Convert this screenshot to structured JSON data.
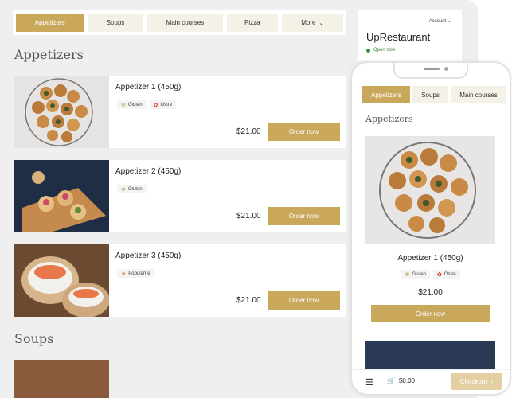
{
  "nav": {
    "tabs": [
      "Appetizers",
      "Soups",
      "Main courses",
      "Pizza",
      "More"
    ]
  },
  "restaurant": {
    "account": "Account",
    "name": "UpRestaurant",
    "status": "Open now"
  },
  "sections": {
    "appetizers": "Appetizers",
    "soups": "Soups"
  },
  "items": [
    {
      "name": "Appetizer 1 (450g)",
      "tags": [
        "Gluten",
        "Ostre"
      ],
      "price": "$21.00",
      "order": "Order now"
    },
    {
      "name": "Appetizer 2 (450g)",
      "tags": [
        "Gluten"
      ],
      "price": "$21.00",
      "order": "Order now"
    },
    {
      "name": "Appetizer 3 (450g)",
      "tags": [
        "Popularne"
      ],
      "price": "$21.00",
      "order": "Order now"
    }
  ],
  "mobile": {
    "tabs": [
      "Appetizers",
      "Soups",
      "Main courses"
    ],
    "section": "Appetizers",
    "item": {
      "name": "Appetizer 1 (450g)",
      "tags": [
        "Gluten",
        "Ostre"
      ],
      "price": "$21.00",
      "order": "Order now"
    },
    "cart_total": "$0.00",
    "checkout": "Checkout"
  },
  "colors": {
    "accent": "#c9a85c",
    "background": "#efefef",
    "open": "#2e9a3a"
  },
  "icons": {
    "gluten": "wheat-icon",
    "ostre": "chili-icon",
    "popularne": "award-icon"
  }
}
